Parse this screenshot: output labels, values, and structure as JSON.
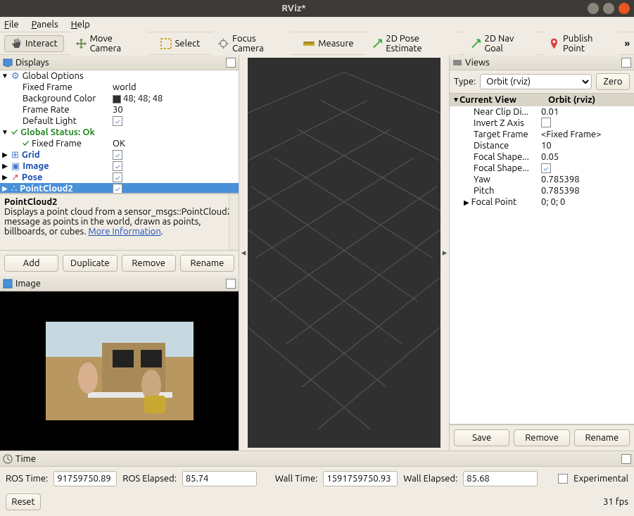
{
  "window": {
    "title": "RViz*"
  },
  "menu": {
    "file": "File",
    "panels": "Panels",
    "help": "Help"
  },
  "toolbar": {
    "interact": "Interact",
    "moveCamera": "Move Camera",
    "select": "Select",
    "focusCamera": "Focus Camera",
    "measure": "Measure",
    "poseEstimate": "2D Pose Estimate",
    "navGoal": "2D Nav Goal",
    "publishPoint": "Publish Point",
    "more": "»"
  },
  "displays": {
    "title": "Displays",
    "globalOptions": "Global Options",
    "fixedFrame": {
      "label": "Fixed Frame",
      "value": "world"
    },
    "backgroundColor": {
      "label": "Background Color",
      "value": "48; 48; 48"
    },
    "frameRate": {
      "label": "Frame Rate",
      "value": "30"
    },
    "defaultLight": {
      "label": "Default Light",
      "checked": true
    },
    "globalStatus": {
      "label": "Global Status: Ok"
    },
    "fixedFrameStatus": {
      "label": "Fixed Frame",
      "value": "OK"
    },
    "grid": "Grid",
    "image": "Image",
    "pose": "Pose",
    "pointcloud2": "PointCloud2",
    "desc": {
      "title": "PointCloud2",
      "body": "Displays a point cloud from a sensor_msgs::PointCloud2 message as points in the world, drawn as points, billboards, or cubes. ",
      "link": "More Information"
    },
    "buttons": {
      "add": "Add",
      "duplicate": "Duplicate",
      "remove": "Remove",
      "rename": "Rename"
    }
  },
  "imagePanel": {
    "title": "Image"
  },
  "views": {
    "title": "Views",
    "typeLabel": "Type:",
    "type": "Orbit (rviz)",
    "zero": "Zero",
    "header": {
      "c1": "Current View",
      "c2": "Orbit (rviz)"
    },
    "rows": [
      {
        "k": "Near Clip Di...",
        "v": "0.01"
      },
      {
        "k": "Invert Z Axis",
        "v": "",
        "chk": false
      },
      {
        "k": "Target Frame",
        "v": "<Fixed Frame>"
      },
      {
        "k": "Distance",
        "v": "10"
      },
      {
        "k": "Focal Shape...",
        "v": "0.05"
      },
      {
        "k": "Focal Shape...",
        "v": "",
        "chk": true
      },
      {
        "k": "Yaw",
        "v": "0.785398"
      },
      {
        "k": "Pitch",
        "v": "0.785398"
      },
      {
        "k": "Focal Point",
        "v": "0; 0; 0",
        "exp": true
      }
    ],
    "buttons": {
      "save": "Save",
      "remove": "Remove",
      "rename": "Rename"
    }
  },
  "time": {
    "title": "Time",
    "rosTimeLabel": "ROS Time:",
    "rosTime": "91759750.89",
    "rosElapsedLabel": "ROS Elapsed:",
    "rosElapsed": "85.74",
    "wallTimeLabel": "Wall Time:",
    "wallTime": "1591759750.93",
    "wallElapsedLabel": "Wall Elapsed:",
    "wallElapsed": "85.68",
    "experimental": "Experimental"
  },
  "footer": {
    "reset": "Reset",
    "fps": "31 fps"
  }
}
